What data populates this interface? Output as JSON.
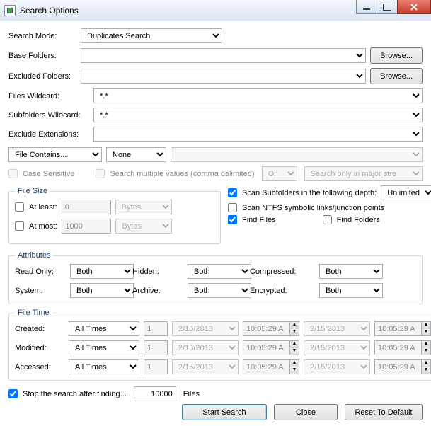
{
  "window": {
    "title": "Search Options"
  },
  "labels": {
    "search_mode": "Search Mode:",
    "base_folders": "Base Folders:",
    "excluded_folders": "Excluded Folders:",
    "files_wildcard": "Files Wildcard:",
    "subfolders_wildcard": "Subfolders Wildcard:",
    "exclude_extensions": "Exclude Extensions:",
    "case_sensitive": "Case Sensitive",
    "search_multiple": "Search multiple values (comma delimited)",
    "search_only_placeholder": "Search only in major stre",
    "file_size_legend": "File Size",
    "at_least": "At least:",
    "at_most": "At most:",
    "scan_subfolders": "Scan Subfolders in the following depth:",
    "scan_ntfs": "Scan NTFS symbolic links/junction points",
    "find_files": "Find Files",
    "find_folders": "Find Folders",
    "attributes_legend": "Attributes",
    "read_only": "Read Only:",
    "hidden": "Hidden:",
    "compressed": "Compressed:",
    "system": "System:",
    "archive": "Archive:",
    "encrypted": "Encrypted:",
    "file_time_legend": "File Time",
    "created": "Created:",
    "modified": "Modified:",
    "accessed": "Accessed:",
    "stop_after": "Stop the search after finding...",
    "files_suffix": "Files"
  },
  "values": {
    "search_mode": "Duplicates Search",
    "base_folders": "",
    "excluded_folders": "",
    "files_wildcard": "*.*",
    "subfolders_wildcard": "*.*",
    "exclude_extensions": "",
    "file_contains": "File Contains...",
    "file_contains_mode": "None",
    "file_contains_text": "",
    "or_and": "Or",
    "at_least": "0",
    "at_most": "1000",
    "unit": "Bytes",
    "depth": "Unlimited",
    "attr": "Both",
    "time_mode": "All Times",
    "time_n": "1",
    "date": "2/15/2013",
    "time": "10:05:29 A",
    "stop_count": "10000"
  },
  "buttons": {
    "browse": "Browse...",
    "start": "Start Search",
    "close": "Close",
    "reset": "Reset To Default"
  }
}
